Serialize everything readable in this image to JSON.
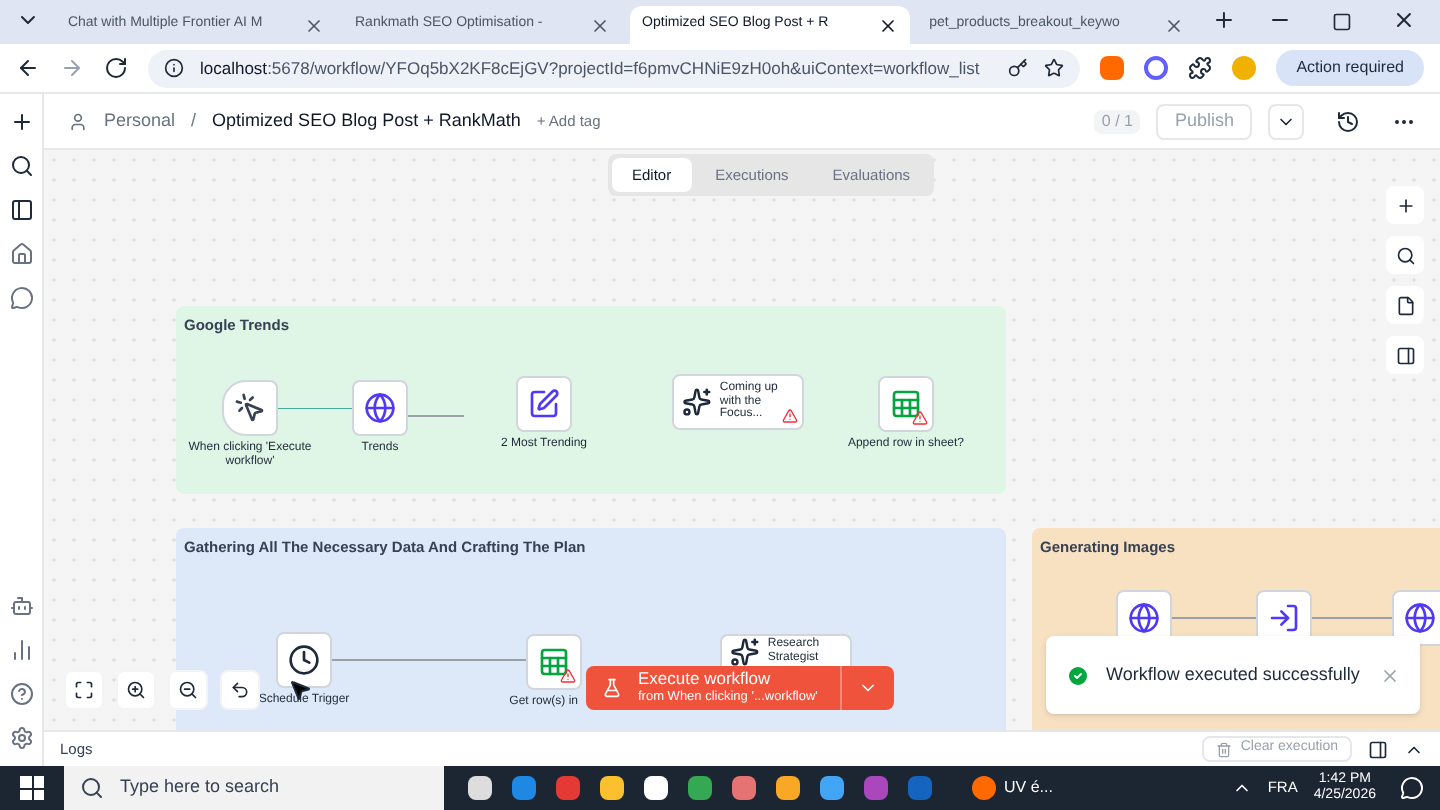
{
  "browser": {
    "tabs": [
      {
        "title": "Chat with Multiple Frontier AI M",
        "selected": false
      },
      {
        "title": "Rankmath SEO Optimisation - ",
        "selected": false
      },
      {
        "title": "Optimized SEO Blog Post + R",
        "selected": true
      },
      {
        "title": "pet_products_breakout_keywo",
        "selected": false
      }
    ],
    "url_host": "localhost",
    "url_rest": ":5678/workflow/YFOq5bX2KF8cEjGV?projectId=f6pmvCHNiE9zH0oh&uiContext=workflow_list",
    "action": "Action required"
  },
  "header": {
    "project": "Personal",
    "separator": "/",
    "title": "Optimized SEO Blog Post + RankMath",
    "add_tag": "+ Add tag",
    "count": "0 / 1",
    "publish": "Publish"
  },
  "view_tabs": [
    {
      "label": "Editor",
      "selected": true
    },
    {
      "label": "Executions",
      "selected": false
    },
    {
      "label": "Evaluations",
      "selected": false
    }
  ],
  "groups": [
    {
      "title": "Google Trends",
      "color": "#dff5e5"
    },
    {
      "title": "Gathering All The Necessary Data And Crafting The Plan",
      "color": "#dde9f8"
    },
    {
      "title": "Generating Images",
      "color": "#f8e1c1"
    }
  ],
  "nodes": [
    {
      "label": "When clicking 'Execute workflow'",
      "kind": "trigger",
      "warning": false
    },
    {
      "label": "Trends",
      "kind": "globe",
      "warning": false
    },
    {
      "label": "2 Most Trending",
      "kind": "edit",
      "warning": false
    },
    {
      "label": "Coming up with the Focus...",
      "kind": "ai",
      "warning": true
    },
    {
      "label": "Append row in sheet?",
      "kind": "sheet",
      "warning": true
    },
    {
      "label": "Schedule Trigger",
      "kind": "clock",
      "warning": false
    },
    {
      "label": "Get row(s) in",
      "kind": "sheet",
      "warning": true
    },
    {
      "label": "Research Strategist",
      "kind": "ai",
      "warning": false
    },
    {
      "kind": "globe",
      "warning": false
    },
    {
      "kind": "enter",
      "warning": false
    },
    {
      "kind": "globe",
      "warning": false
    }
  ],
  "execute": {
    "title": "Execute workflow",
    "subtitle": "from When clicking '...workflow'"
  },
  "toast": {
    "message": "Workflow executed successfully"
  },
  "logs": {
    "title": "Logs",
    "clear": "Clear execution"
  },
  "taskbar": {
    "search": "Type here to search",
    "tray_app": "UV é...",
    "language": "FRA",
    "time": "1:42 PM",
    "date": "4/25/2026"
  }
}
